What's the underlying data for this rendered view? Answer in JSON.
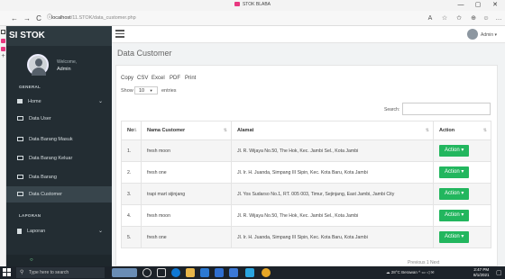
{
  "browser": {
    "tab_title": "STOK BLABA",
    "url_host": "localhost",
    "url_path": "/11.STOK/data_customer.php",
    "back_icon": "←",
    "forward_icon": "→",
    "reload_icon": "C",
    "info_icon": "ⓘ",
    "toolbar_icons": [
      "A",
      "☆",
      "✩",
      "⊕",
      "☺",
      "…"
    ],
    "window_buttons": [
      "—",
      "▢",
      "✕"
    ]
  },
  "sidebar": {
    "brand": "SI STOK",
    "welcome": "Welcome,",
    "user": "Admin",
    "section_general": "GENERAL",
    "items": [
      {
        "label": "Home",
        "chevron": "⌄"
      },
      {
        "label": "Data User"
      },
      {
        "label": "Data Barang Masuk"
      },
      {
        "label": "Data Barang Keluar"
      },
      {
        "label": "Data Barang"
      },
      {
        "label": "Data Customer"
      }
    ],
    "section_laporan": "LAPORAN",
    "laporan": {
      "label": "Laporan",
      "chevron": "⌄"
    }
  },
  "topnav": {
    "menu_icon": "hamburger-icon",
    "user_label": "Admin ▾"
  },
  "page": {
    "title": "Data Customer",
    "export_buttons": [
      "Copy",
      "CSV",
      "Excel",
      "PDF",
      "Print"
    ],
    "show_label": "Show",
    "entries_value": "10",
    "entries_label": "entries",
    "search_label": "Search:",
    "columns": [
      "No",
      "Nama Customer",
      "Alamat",
      "Action"
    ],
    "rows": [
      {
        "no": "1.",
        "nama": "fresh moon",
        "alamat": "Jl. R. Wijaya No.50, The Hok, Kec. Jambi Sel., Kota Jambi",
        "action": "Action ▾"
      },
      {
        "no": "2.",
        "nama": "fresh one",
        "alamat": "Jl. Ir. H. Juanda, Simpang III Sipin, Kec. Kota Baru, Kota Jambi",
        "action": "Action ▾"
      },
      {
        "no": "3.",
        "nama": "trapi mart sijinjang",
        "alamat": "Jl. Yos Sudarso No.1, RT. 005 003, Timur, Sejinjang, East Jambi, Jambi City",
        "action": "Action ▾"
      },
      {
        "no": "4.",
        "nama": "fresh moon",
        "alamat": "Jl. R. Wijaya No.50, The Hok, Kec. Jambi Sel., Kota Jambi",
        "action": "Action ▾"
      },
      {
        "no": "5.",
        "nama": "fresh one",
        "alamat": "Jl. Ir. H. Juanda, Simpang III Sipin, Kec. Kota Baru, Kota Jambi",
        "action": "Action ▾"
      }
    ],
    "pagination": "Previous  1  Next"
  },
  "taskbar": {
    "search_placeholder": "Type here to search",
    "weather": "28°C  Berawan",
    "time": "2:47 PM",
    "date": "8/1/2021",
    "accent": "#22b65e"
  }
}
